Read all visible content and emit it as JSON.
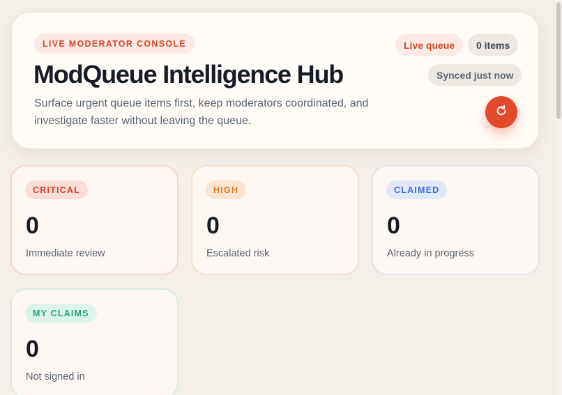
{
  "hero": {
    "eyebrow": "LIVE MODERATOR CONSOLE",
    "title": "ModQueue Intelligence Hub",
    "description": "Surface urgent queue items first, keep moderators coordinated, and investigate faster without leaving the queue.",
    "live_label": "Live queue",
    "count_label": "0 items",
    "sync_label": "Synced just now",
    "refresh_icon": "refresh-icon"
  },
  "stats": [
    {
      "badge": "CRITICAL",
      "value": "0",
      "caption": "Immediate review",
      "color": "#d6402c"
    },
    {
      "badge": "HIGH",
      "value": "0",
      "caption": "Escalated risk",
      "color": "#e07a23"
    },
    {
      "badge": "CLAIMED",
      "value": "0",
      "caption": "Already in progress",
      "color": "#3a6fd8"
    },
    {
      "badge": "MY CLAIMS",
      "value": "0",
      "caption": "Not signed in",
      "color": "#22a47f"
    }
  ],
  "colors": {
    "accent": "#e2492a",
    "background": "#f4efe9"
  }
}
